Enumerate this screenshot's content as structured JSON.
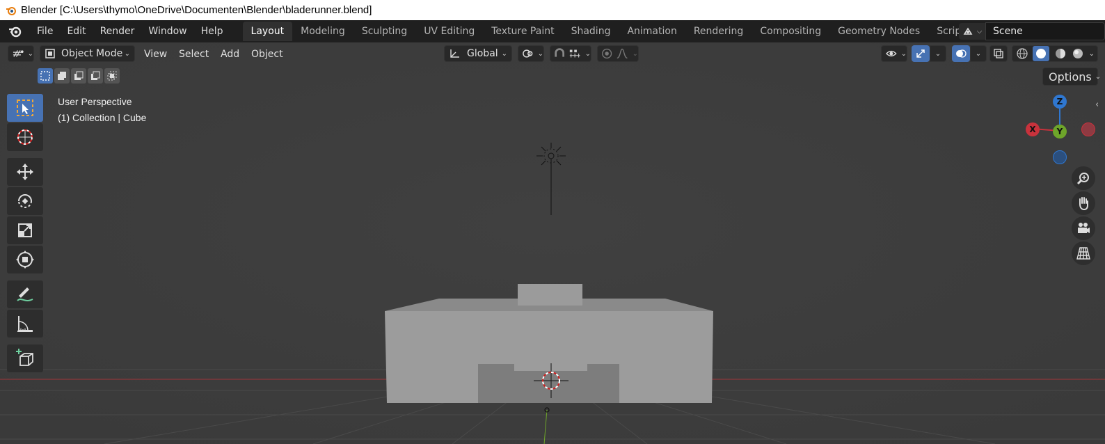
{
  "window": {
    "title": "Blender [C:\\Users\\thymo\\OneDrive\\Documenten\\Blender\\bladerunner.blend]"
  },
  "topbar": {
    "menus": [
      "File",
      "Edit",
      "Render",
      "Window",
      "Help"
    ],
    "workspaces": [
      "Layout",
      "Modeling",
      "Sculpting",
      "UV Editing",
      "Texture Paint",
      "Shading",
      "Animation",
      "Rendering",
      "Compositing",
      "Geometry Nodes",
      "Scripting"
    ],
    "active_workspace": "Layout",
    "add_workspace_icon": "plus-icon",
    "scene_name": "Scene"
  },
  "viewport_header": {
    "mode": "Object Mode",
    "menus": [
      "View",
      "Select",
      "Add",
      "Object"
    ],
    "transform_orientation": "Global",
    "options_label": "Options"
  },
  "viewport": {
    "perspective_label": "User Perspective",
    "collection_label": "(1) Collection | Cube",
    "axes": {
      "x": "X",
      "y": "Y",
      "z": "Z"
    },
    "colors": {
      "background": "#3d3d3d",
      "x_axis": "#c8323c",
      "y_axis": "#6ea52a",
      "z_axis": "#2f77d0",
      "accent": "#4772b3"
    }
  },
  "toolbar": {
    "tools": [
      "select-box-icon",
      "cursor-icon",
      "move-icon",
      "rotate-icon",
      "scale-icon",
      "transform-icon",
      "annotate-icon",
      "measure-icon",
      "add-cube-icon"
    ],
    "active_tool": "select-box-icon"
  }
}
